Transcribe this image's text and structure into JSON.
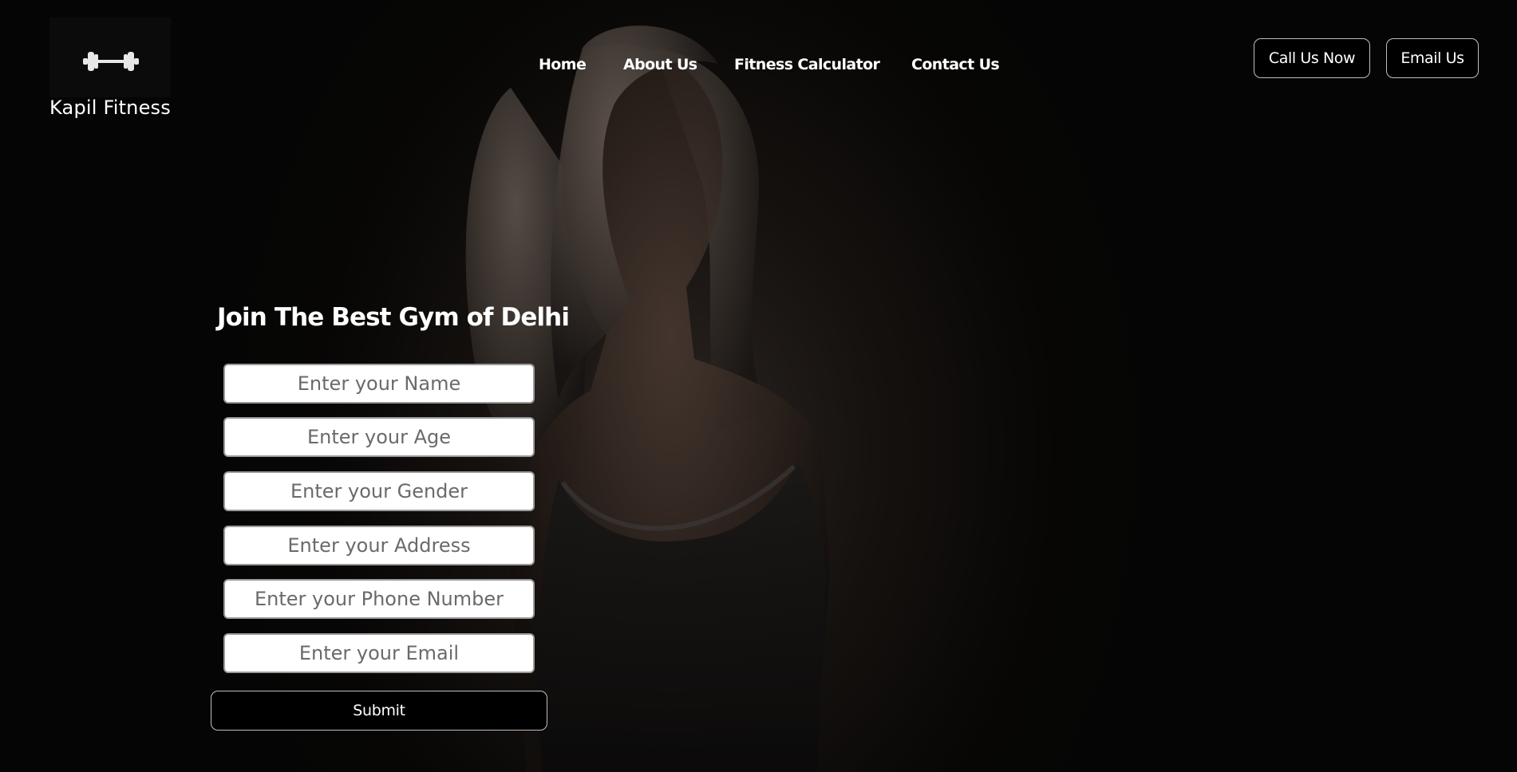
{
  "brand": {
    "name": "Kapil Fitness",
    "icon": "dumbbell-icon"
  },
  "nav": {
    "items": [
      {
        "label": "Home"
      },
      {
        "label": "About Us"
      },
      {
        "label": "Fitness Calculator"
      },
      {
        "label": "Contact Us"
      }
    ]
  },
  "header_actions": {
    "call_label": "Call Us Now",
    "email_label": "Email Us"
  },
  "form": {
    "title": "Join The Best Gym of Delhi",
    "fields": [
      {
        "placeholder": "Enter your Name",
        "value": ""
      },
      {
        "placeholder": "Enter your Age",
        "value": ""
      },
      {
        "placeholder": "Enter your Gender",
        "value": ""
      },
      {
        "placeholder": "Enter your Address",
        "value": ""
      },
      {
        "placeholder": "Enter your Phone Number",
        "value": ""
      },
      {
        "placeholder": "Enter your Email",
        "value": ""
      }
    ],
    "submit_label": "Submit"
  },
  "colors": {
    "background": "#000000",
    "text": "#ffffff",
    "button_border": "#bfbfbf"
  }
}
